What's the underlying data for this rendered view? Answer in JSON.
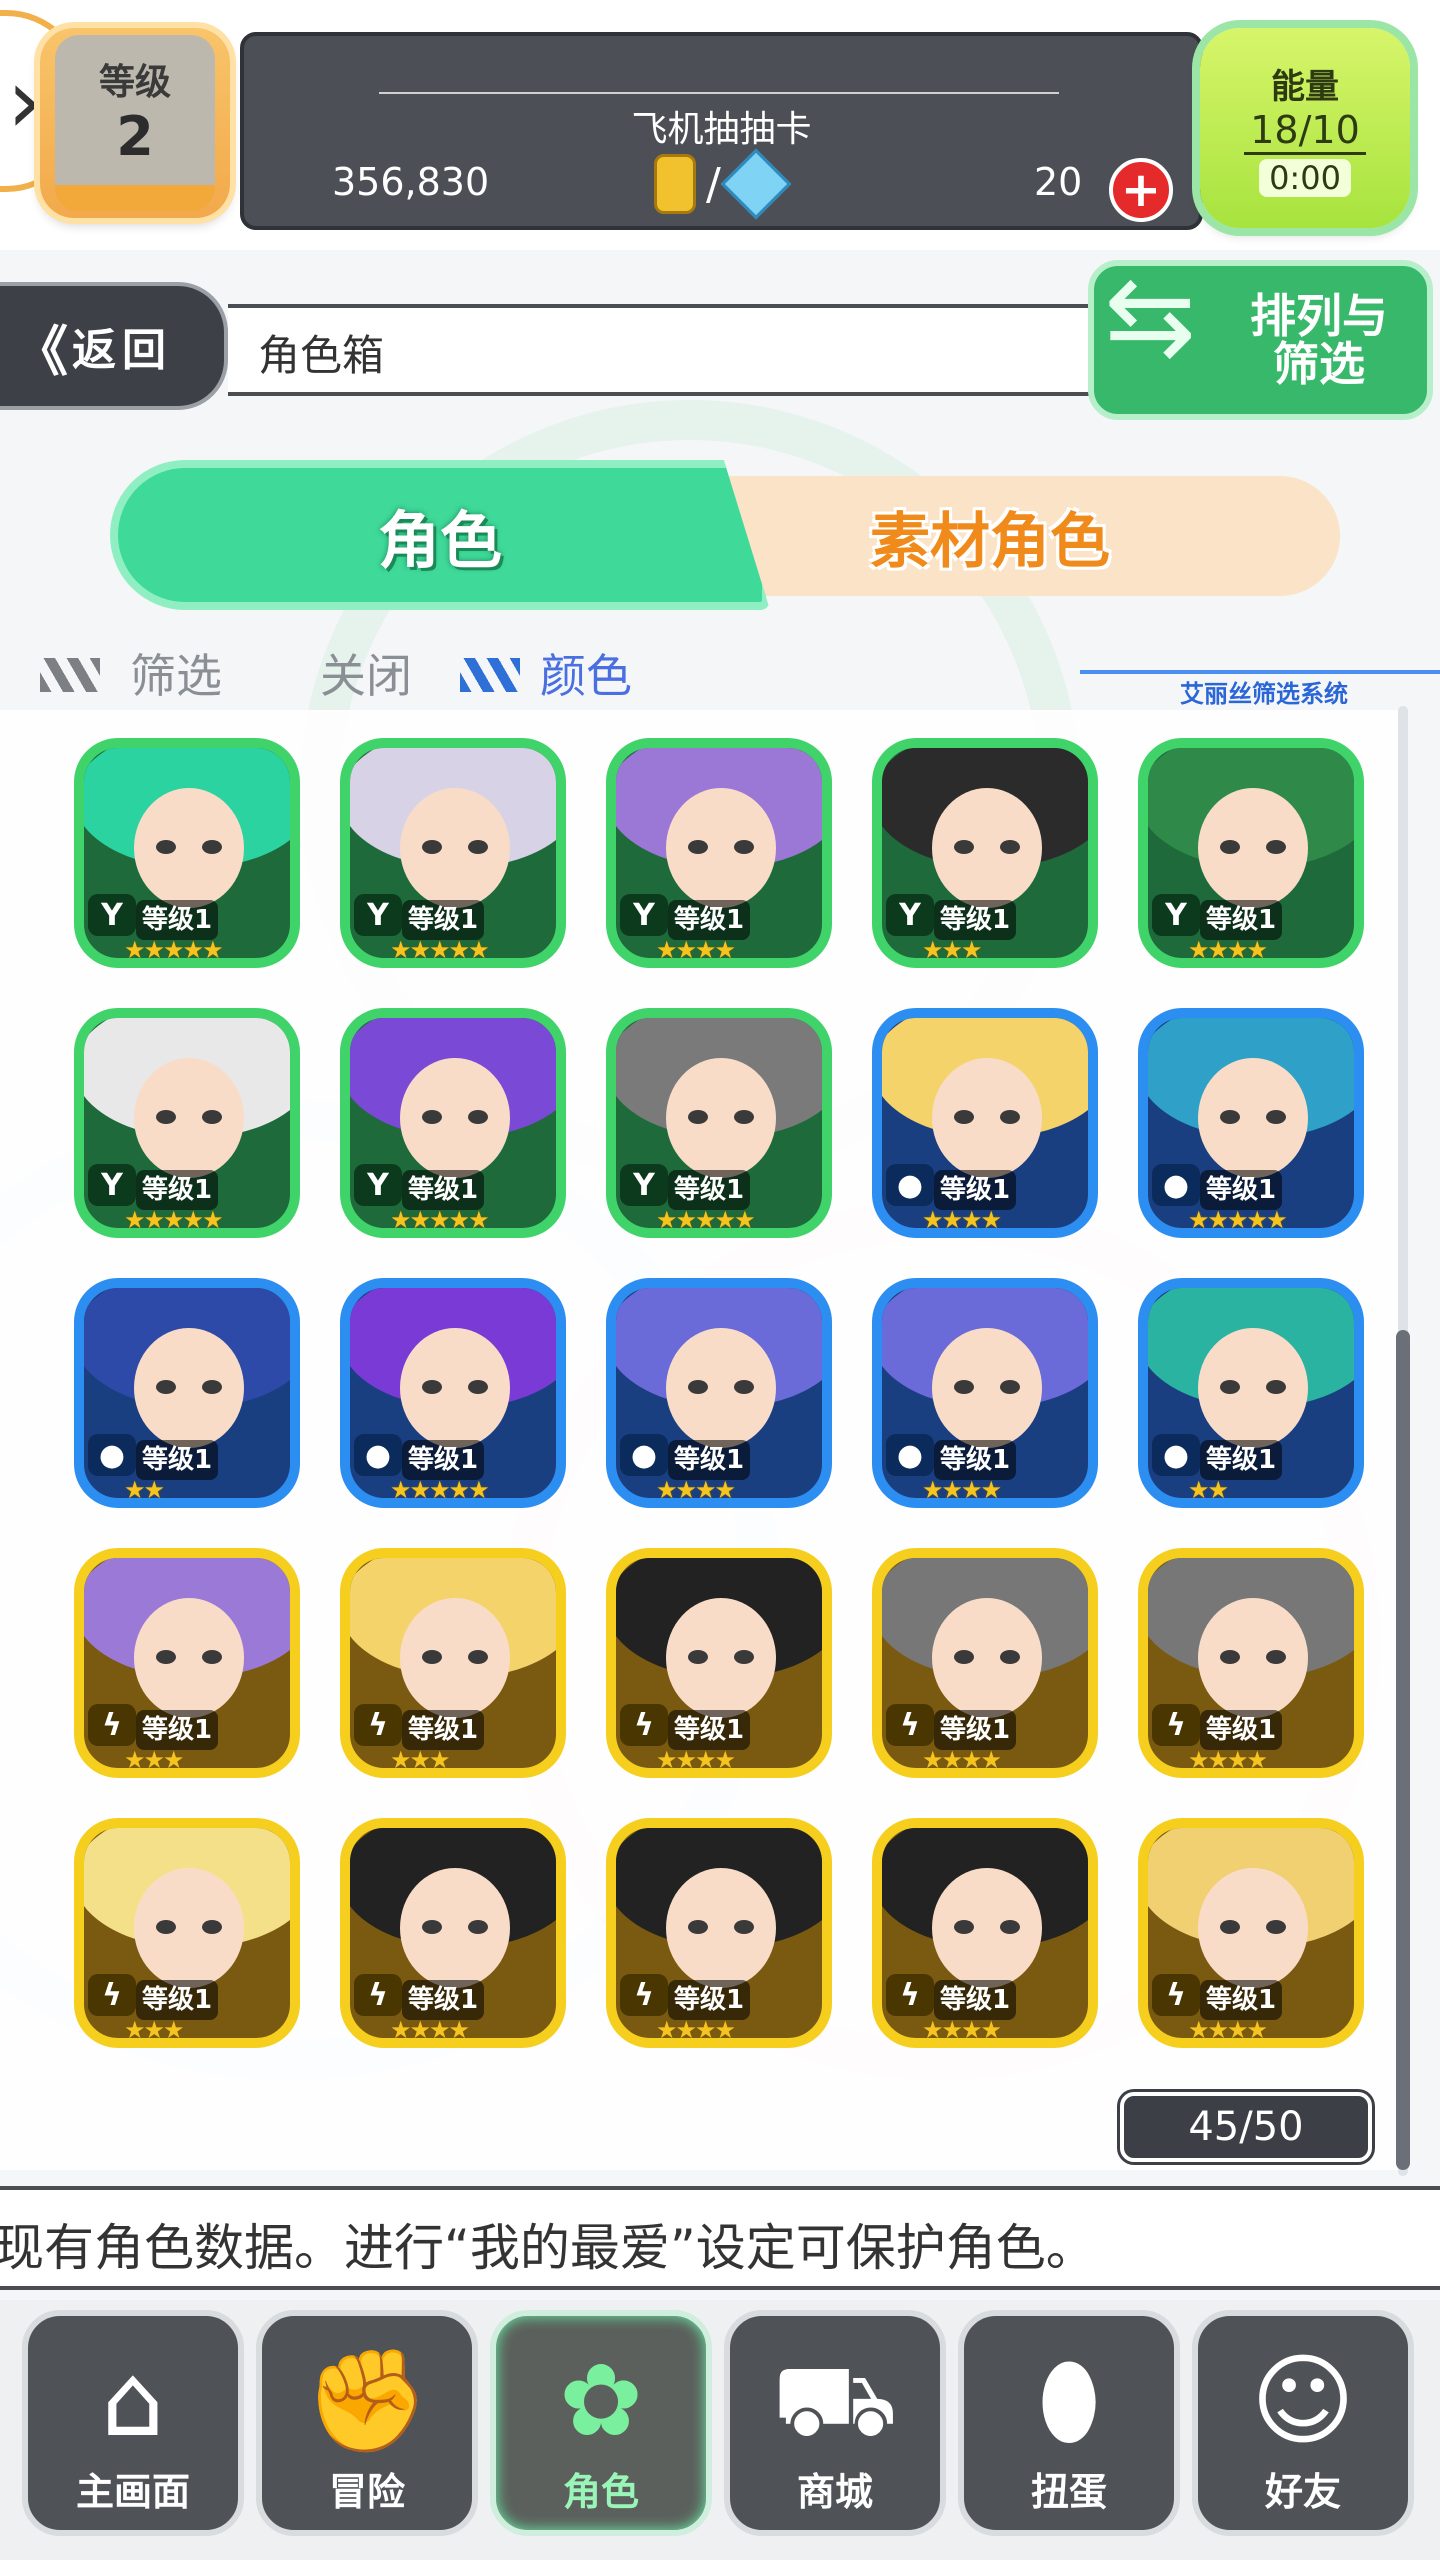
{
  "header": {
    "level_label": "等级",
    "level_value": "2",
    "title": "飞机抽抽卡",
    "gold": "356,830",
    "gems": "20",
    "energy_label": "能量",
    "energy_value": "18/10",
    "energy_timer": "0:00"
  },
  "nav_bar": {
    "back_label": "返回",
    "page_label": "角色箱",
    "sort_label": "排列与筛选"
  },
  "tabs": {
    "character": "角色",
    "material": "素材角色"
  },
  "filter": {
    "label": "筛选",
    "state": "关闭",
    "value": "颜色",
    "system_label": "艾丽丝筛选系统"
  },
  "characters": [
    {
      "element": "green",
      "level": "等级1",
      "stars": 5
    },
    {
      "element": "green",
      "level": "等级1",
      "stars": 5
    },
    {
      "element": "green",
      "level": "等级1",
      "stars": 4
    },
    {
      "element": "green",
      "level": "等级1",
      "stars": 3
    },
    {
      "element": "green",
      "level": "等级1",
      "stars": 4
    },
    {
      "element": "green",
      "level": "等级1",
      "stars": 5
    },
    {
      "element": "green",
      "level": "等级1",
      "stars": 5
    },
    {
      "element": "green",
      "level": "等级1",
      "stars": 5
    },
    {
      "element": "blue",
      "level": "等级1",
      "stars": 4
    },
    {
      "element": "blue",
      "level": "等级1",
      "stars": 5
    },
    {
      "element": "blue",
      "level": "等级1",
      "stars": 2
    },
    {
      "element": "blue",
      "level": "等级1",
      "stars": 5
    },
    {
      "element": "blue",
      "level": "等级1",
      "stars": 4
    },
    {
      "element": "blue",
      "level": "等级1",
      "stars": 4
    },
    {
      "element": "blue",
      "level": "等级1",
      "stars": 2
    },
    {
      "element": "yellow",
      "level": "等级1",
      "stars": 3
    },
    {
      "element": "yellow",
      "level": "等级1",
      "stars": 3
    },
    {
      "element": "yellow",
      "level": "等级1",
      "stars": 4
    },
    {
      "element": "yellow",
      "level": "等级1",
      "stars": 4
    },
    {
      "element": "yellow",
      "level": "等级1",
      "stars": 4
    },
    {
      "element": "yellow",
      "level": "等级1",
      "stars": 3
    },
    {
      "element": "yellow",
      "level": "等级1",
      "stars": 4
    },
    {
      "element": "yellow",
      "level": "等级1",
      "stars": 4
    },
    {
      "element": "yellow",
      "level": "等级1",
      "stars": 4
    },
    {
      "element": "yellow",
      "level": "等级1",
      "stars": 4
    }
  ],
  "box_count": "45/50",
  "info_text": "现有角色数据。进行“我的最爱”设定可保护角色。",
  "bottom_nav": [
    {
      "label": "主画面",
      "icon": "home-icon"
    },
    {
      "label": "冒险",
      "icon": "handshake-icon"
    },
    {
      "label": "角色",
      "icon": "rabbit-icon"
    },
    {
      "label": "商城",
      "icon": "cart-icon"
    },
    {
      "label": "扭蛋",
      "icon": "egg-icon"
    },
    {
      "label": "好友",
      "icon": "friends-icon"
    }
  ],
  "colors": {
    "green": "#3fd36a",
    "blue": "#2d8ef2",
    "yellow": "#f6cf1e"
  }
}
